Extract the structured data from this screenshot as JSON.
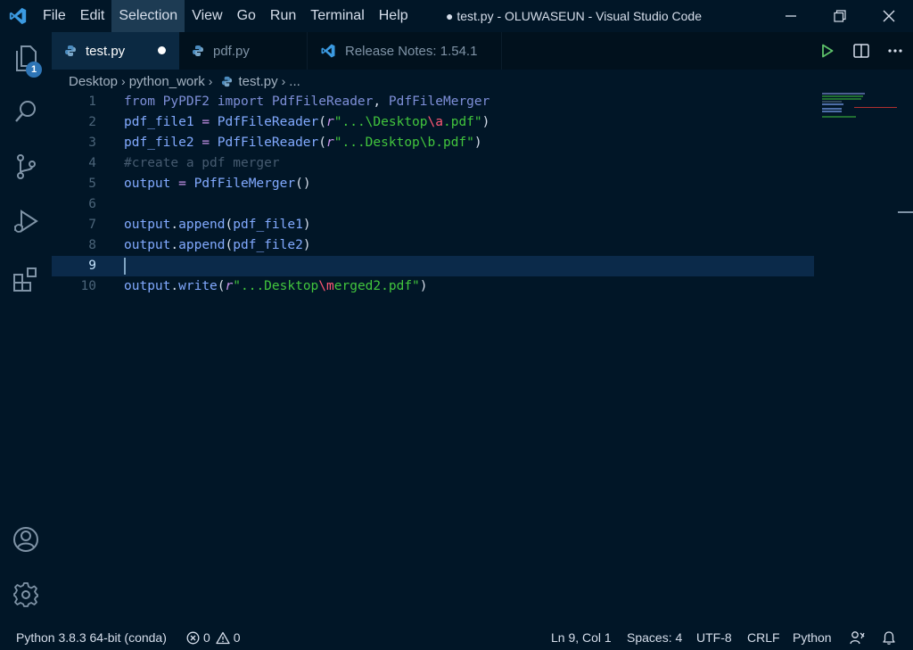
{
  "window": {
    "title": "● test.py - OLUWASEUN - Visual Studio Code",
    "accent_color": "#2e75b6"
  },
  "menu": [
    "File",
    "Edit",
    "Selection",
    "View",
    "Go",
    "Run",
    "Terminal",
    "Help"
  ],
  "activity_bar": {
    "explorer_badge": "1",
    "icons": [
      "files-icon",
      "search-icon",
      "source-control-icon",
      "run-debug-icon",
      "extensions-icon",
      "account-icon",
      "settings-gear-icon"
    ]
  },
  "tabs": [
    {
      "label": "test.py",
      "active": true,
      "dirty": true,
      "icon": "python-icon"
    },
    {
      "label": "pdf.py",
      "active": false,
      "icon": "python-icon"
    },
    {
      "label": "Release Notes: 1.54.1",
      "active": false,
      "icon": "vscode-icon"
    }
  ],
  "breadcrumb": [
    "Desktop",
    "python_work",
    "test.py",
    "..."
  ],
  "editor": {
    "line_numbers": [
      "1",
      "2",
      "3",
      "4",
      "5",
      "6",
      "7",
      "8",
      "9",
      "10"
    ],
    "current_line": 9,
    "lines": [
      [
        {
          "t": "from",
          "c": "kw"
        },
        {
          "t": " ",
          "c": "pun"
        },
        {
          "t": "PyPDF2",
          "c": "mod"
        },
        {
          "t": " ",
          "c": "pun"
        },
        {
          "t": "import",
          "c": "kw"
        },
        {
          "t": " ",
          "c": "pun"
        },
        {
          "t": "PdfFileReader",
          "c": "cls"
        },
        {
          "t": ", ",
          "c": "pun"
        },
        {
          "t": "PdfFileMerger",
          "c": "cls"
        }
      ],
      [
        {
          "t": "pdf_file1",
          "c": "var"
        },
        {
          "t": " ",
          "c": "pun"
        },
        {
          "t": "=",
          "c": "op"
        },
        {
          "t": " ",
          "c": "pun"
        },
        {
          "t": "PdfFileReader",
          "c": "fn"
        },
        {
          "t": "(",
          "c": "pun"
        },
        {
          "t": "r",
          "c": "rp"
        },
        {
          "t": "\"...\\Desktop",
          "c": "str"
        },
        {
          "t": "\\a",
          "c": "esc"
        },
        {
          "t": ".pdf\"",
          "c": "str"
        },
        {
          "t": ")",
          "c": "pun"
        }
      ],
      [
        {
          "t": "pdf_file2",
          "c": "var"
        },
        {
          "t": " ",
          "c": "pun"
        },
        {
          "t": "=",
          "c": "op"
        },
        {
          "t": " ",
          "c": "pun"
        },
        {
          "t": "PdfFileReader",
          "c": "fn"
        },
        {
          "t": "(",
          "c": "pun"
        },
        {
          "t": "r",
          "c": "rp"
        },
        {
          "t": "\"...Desktop\\b.pdf\"",
          "c": "str"
        },
        {
          "t": ")",
          "c": "pun"
        }
      ],
      [
        {
          "t": "#create a pdf merger",
          "c": "cmt"
        }
      ],
      [
        {
          "t": "output",
          "c": "var"
        },
        {
          "t": " ",
          "c": "pun"
        },
        {
          "t": "=",
          "c": "op"
        },
        {
          "t": " ",
          "c": "pun"
        },
        {
          "t": "PdfFileMerger",
          "c": "fn"
        },
        {
          "t": "()",
          "c": "pun"
        }
      ],
      [],
      [
        {
          "t": "output",
          "c": "var"
        },
        {
          "t": ".",
          "c": "pun"
        },
        {
          "t": "append",
          "c": "fn"
        },
        {
          "t": "(",
          "c": "pun"
        },
        {
          "t": "pdf_file1",
          "c": "var"
        },
        {
          "t": ")",
          "c": "pun"
        }
      ],
      [
        {
          "t": "output",
          "c": "var"
        },
        {
          "t": ".",
          "c": "pun"
        },
        {
          "t": "append",
          "c": "fn"
        },
        {
          "t": "(",
          "c": "pun"
        },
        {
          "t": "pdf_file2",
          "c": "var"
        },
        {
          "t": ")",
          "c": "pun"
        }
      ],
      [],
      [
        {
          "t": "output",
          "c": "var"
        },
        {
          "t": ".",
          "c": "pun"
        },
        {
          "t": "write",
          "c": "fn"
        },
        {
          "t": "(",
          "c": "pun"
        },
        {
          "t": "r",
          "c": "rp"
        },
        {
          "t": "\"...Desktop",
          "c": "str"
        },
        {
          "t": "\\m",
          "c": "esc"
        },
        {
          "t": "erged2.pdf\"",
          "c": "str"
        },
        {
          "t": ")",
          "c": "pun"
        }
      ]
    ]
  },
  "status_bar": {
    "interpreter": "Python 3.8.3 64-bit (conda)",
    "errors": "0",
    "warnings": "0",
    "position": "Ln 9, Col 1",
    "indent": "Spaces: 4",
    "encoding": "UTF-8",
    "eol": "CRLF",
    "language": "Python"
  }
}
